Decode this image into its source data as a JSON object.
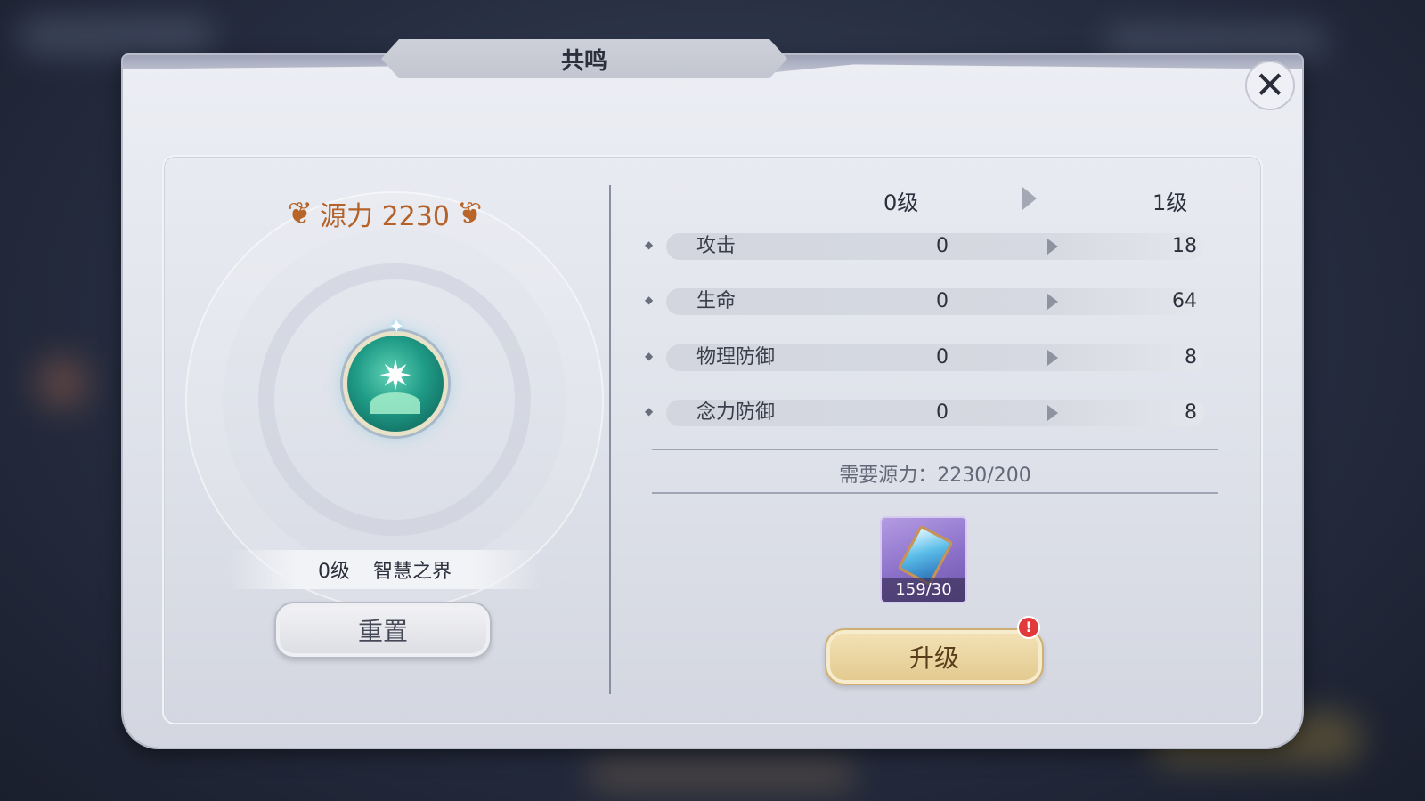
{
  "panel": {
    "title": "共鸣",
    "close_icon_glyph": "✕"
  },
  "left": {
    "source_power_label": "源力 2230",
    "realm_level": "0级",
    "realm_name": "智慧之界",
    "reset_label": "重置"
  },
  "right": {
    "level_from": "0级",
    "level_to": "1级",
    "stats": [
      {
        "name": "攻击",
        "from": "0",
        "to": "18"
      },
      {
        "name": "生命",
        "from": "0",
        "to": "64"
      },
      {
        "name": "物理防御",
        "from": "0",
        "to": "8"
      },
      {
        "name": "念力防御",
        "from": "0",
        "to": "8"
      }
    ],
    "cost_text": "需要源力：2230/200",
    "item_count": "159/30",
    "upgrade_label": "升级",
    "alert_glyph": "!"
  },
  "colors": {
    "accent_orange": "#b4622a",
    "upgrade_gold": "#e2c98d",
    "alert_red": "#e23a3a",
    "item_purple": "#8a6fc8"
  }
}
